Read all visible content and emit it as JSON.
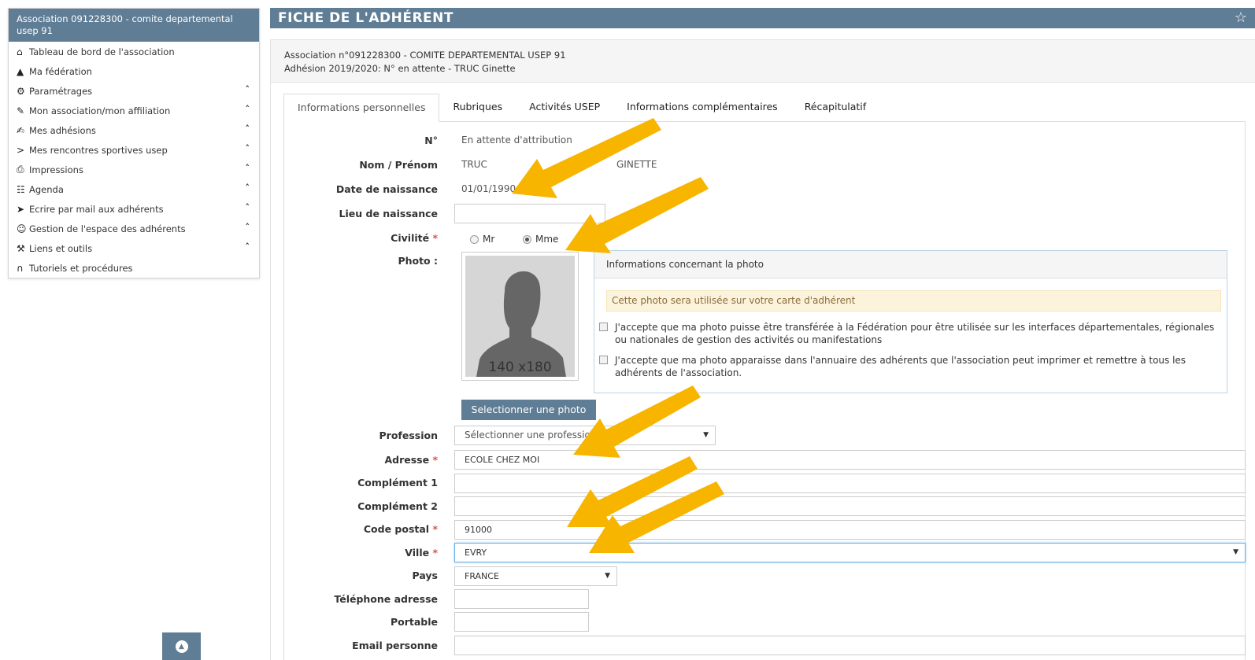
{
  "sidebar": {
    "header": "Association 091228300 - comite departemental usep 91",
    "items": [
      {
        "label": "Tableau de bord de l'association",
        "icon": "home-icon",
        "glyph": "⌂",
        "chevron": false
      },
      {
        "label": "Ma fédération",
        "icon": "bank-icon",
        "glyph": "▲",
        "chevron": false
      },
      {
        "label": "Paramétrages",
        "icon": "gear-icon",
        "glyph": "⚙",
        "chevron": true
      },
      {
        "label": "Mon association/mon affiliation",
        "icon": "pencil-icon",
        "glyph": "✎",
        "chevron": true
      },
      {
        "label": "Mes adhésions",
        "icon": "edit-icon",
        "glyph": "✍",
        "chevron": true
      },
      {
        "label": "Mes rencontres sportives usep",
        "icon": "chevron-right-icon",
        "glyph": ">",
        "chevron": true
      },
      {
        "label": "Impressions",
        "icon": "print-icon",
        "glyph": "⎙",
        "chevron": true
      },
      {
        "label": "Agenda",
        "icon": "calendar-icon",
        "glyph": "☷",
        "chevron": true
      },
      {
        "label": "Ecrire par mail aux adhérents",
        "icon": "send-icon",
        "glyph": "➤",
        "chevron": true
      },
      {
        "label": "Gestion de l'espace des adhérents",
        "icon": "user-icon",
        "glyph": "☺",
        "chevron": true
      },
      {
        "label": "Liens et outils",
        "icon": "wrench-icon",
        "glyph": "⚒",
        "chevron": true
      },
      {
        "label": "Tutoriels et procédures",
        "icon": "headphones-icon",
        "glyph": "∩",
        "chevron": false
      }
    ]
  },
  "page": {
    "title": "FICHE DE L'ADHÉRENT",
    "assoc_line": "Association n°091228300 - COMITE DEPARTEMENTAL USEP 91",
    "adhesion_line": "Adhésion 2019/2020: N° en attente - TRUC Ginette"
  },
  "tabs": [
    "Informations personnelles",
    "Rubriques",
    "Activités USEP",
    "Informations complémentaires",
    "Récapitulatif"
  ],
  "form": {
    "labels": {
      "num": "N°",
      "nom": "Nom / Prénom",
      "naissance": "Date de naissance",
      "lieu": "Lieu de naissance",
      "civilite": "Civilité",
      "photo": "Photo :",
      "profession": "Profession",
      "adresse": "Adresse",
      "complement1": "Complément 1",
      "complement2": "Complément 2",
      "cp": "Code postal",
      "ville": "Ville",
      "pays": "Pays",
      "tel": "Téléphone adresse",
      "portable": "Portable",
      "email": "Email personne"
    },
    "required_mark": "*",
    "values": {
      "num": "En attente d'attribution",
      "nom": "TRUC",
      "prenom": "GINETTE",
      "naissance": "01/01/1990",
      "lieu": "",
      "civ_mr": "Mr",
      "civ_mme": "Mme",
      "civ_selected": "Mme",
      "profession": "Sélectionner une profession",
      "adresse": "ECOLE CHEZ MOI",
      "complement1": "",
      "complement2": "",
      "cp": "91000",
      "ville": "EVRY",
      "pays": "FRANCE",
      "tel": "",
      "portable": "",
      "email": ""
    }
  },
  "photo": {
    "placeholder_size": "140 x180",
    "info_title": "Informations concernant la photo",
    "warning": "Cette photo sera utilisée sur votre carte d'adhérent",
    "consent1": "J'accepte que ma photo puisse être transférée à la Fédération pour être utilisée sur les interfaces départementales, régionales ou nationales de gestion des activités ou manifestations",
    "consent2": "J'accepte que ma photo apparaisse dans l'annuaire des adhérents que l'association peut imprimer et remettre à tous les adhérents de l'association.",
    "select_button": "Selectionner une photo"
  },
  "colors": {
    "header_blue": "#5f7d95",
    "annotation_arrow": "#f7b500",
    "required": "#d9534f"
  }
}
